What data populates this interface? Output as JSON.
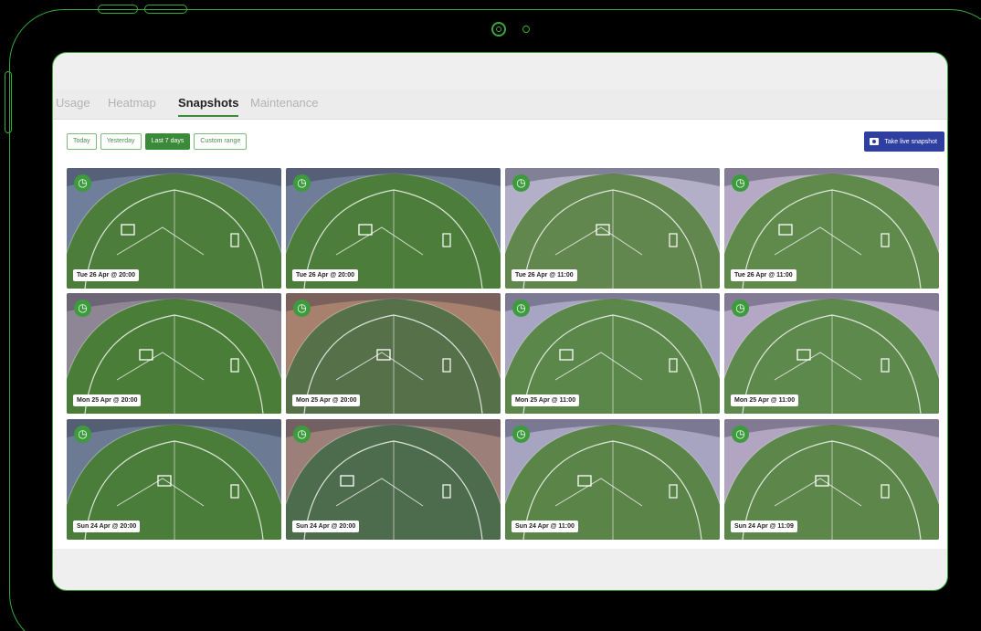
{
  "tabs": [
    {
      "label": "Usage",
      "active": false
    },
    {
      "label": "Heatmap",
      "active": false
    },
    {
      "label": "Snapshots",
      "active": true
    },
    {
      "label": "Maintenance",
      "active": false
    }
  ],
  "filters": [
    {
      "label": "Today",
      "active": false
    },
    {
      "label": "Yesterday",
      "active": false
    },
    {
      "label": "Last 7 days",
      "active": true
    },
    {
      "label": "Custom range",
      "active": false
    }
  ],
  "live_snapshot_label": "Take live snapshot",
  "snapshots": [
    {
      "timestamp": "Tue 26 Apr @ 20:00",
      "sky": "#6f7e9a",
      "grass": "#4c7d3a",
      "icon": "timer-icon"
    },
    {
      "timestamp": "Tue 26 Apr @ 20:00",
      "sky": "#707d99",
      "grass": "#4d7d3a",
      "icon": "timer-icon"
    },
    {
      "timestamp": "Tue 26 Apr @ 11:00",
      "sky": "#b3afc8",
      "grass": "#61864e",
      "icon": "timer-icon"
    },
    {
      "timestamp": "Tue 26 Apr @ 11:00",
      "sky": "#b6a9c5",
      "grass": "#5f8a4c",
      "icon": "timer-icon"
    },
    {
      "timestamp": "Mon 25 Apr @ 20:00",
      "sky": "#8f8695",
      "grass": "#4a7d37",
      "icon": "timer-icon"
    },
    {
      "timestamp": "Mon 25 Apr @ 20:00",
      "sky": "#a8806e",
      "grass": "#56704a",
      "icon": "timer-icon"
    },
    {
      "timestamp": "Mon 25 Apr @ 11:00",
      "sky": "#a8a5c4",
      "grass": "#5b874a",
      "icon": "timer-icon"
    },
    {
      "timestamp": "Mon 25 Apr @ 11:00",
      "sky": "#b4a7c6",
      "grass": "#5e894c",
      "icon": "timer-icon"
    },
    {
      "timestamp": "Sun 24 Apr @ 20:00",
      "sky": "#6c7b93",
      "grass": "#4a7d39",
      "icon": "timer-icon"
    },
    {
      "timestamp": "Sun 24 Apr @ 20:00",
      "sky": "#9c7f78",
      "grass": "#4d6c4d",
      "icon": "timer-icon"
    },
    {
      "timestamp": "Sun 24 Apr @ 11:00",
      "sky": "#a6a4c1",
      "grass": "#5b8448",
      "icon": "timer-icon"
    },
    {
      "timestamp": "Sun 24 Apr @ 11:09",
      "sky": "#b2a5c2",
      "grass": "#5d874a",
      "icon": "timer-icon"
    }
  ],
  "colors": {
    "accent": "#3b8a3a",
    "device_outline": "#3aa83a",
    "live_button": "#2f3fa0"
  }
}
